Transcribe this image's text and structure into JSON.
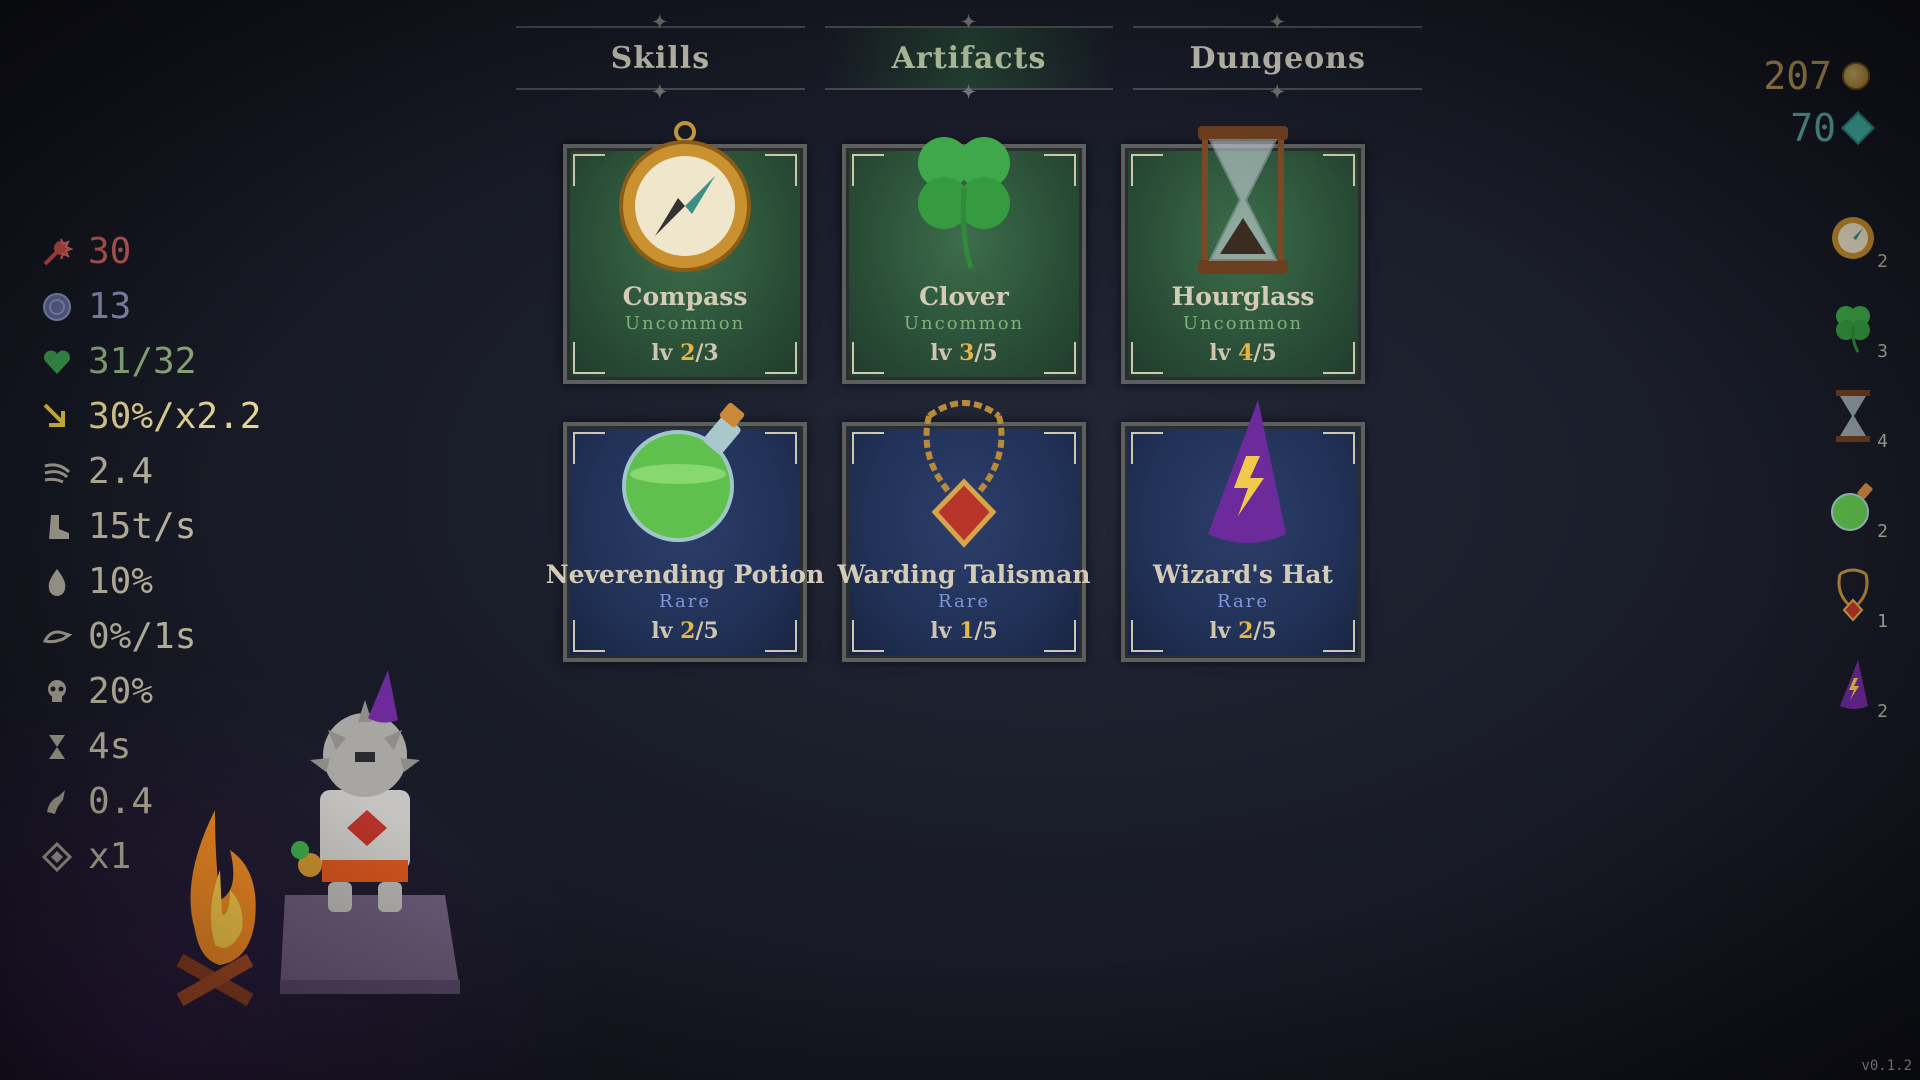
{
  "tabs": [
    {
      "label": "Skills",
      "active": false
    },
    {
      "label": "Artifacts",
      "active": true
    },
    {
      "label": "Dungeons",
      "active": false
    }
  ],
  "currency": {
    "gold": "207",
    "gems": "70"
  },
  "stats": [
    {
      "icon": "attack-icon",
      "value": "30"
    },
    {
      "icon": "armor-icon",
      "value": "13"
    },
    {
      "icon": "heart-icon",
      "value": "31/32"
    },
    {
      "icon": "crit-icon",
      "value": "30%/x2.2"
    },
    {
      "icon": "speed-icon",
      "value": "2.4"
    },
    {
      "icon": "boot-icon",
      "value": "15t/s"
    },
    {
      "icon": "drop-icon",
      "value": "10%"
    },
    {
      "icon": "regen-icon",
      "value": "0%/1s"
    },
    {
      "icon": "skull-icon",
      "value": "20%"
    },
    {
      "icon": "hourglass-icon",
      "value": "4s"
    },
    {
      "icon": "knockback-icon",
      "value": "0.4"
    },
    {
      "icon": "multiplier-icon",
      "value": "x1"
    }
  ],
  "artifacts": [
    {
      "name": "Compass",
      "rarity": "Uncommon",
      "level_prefix": "lv",
      "level_current": "2",
      "level_max": "/3",
      "icon": "compass-icon"
    },
    {
      "name": "Clover",
      "rarity": "Uncommon",
      "level_prefix": "lv",
      "level_current": "3",
      "level_max": "/5",
      "icon": "clover-icon"
    },
    {
      "name": "Hourglass",
      "rarity": "Uncommon",
      "level_prefix": "lv",
      "level_current": "4",
      "level_max": "/5",
      "icon": "hourglass-icon"
    },
    {
      "name": "Neverending Potion",
      "rarity": "Rare",
      "level_prefix": "lv",
      "level_current": "2",
      "level_max": "/5",
      "icon": "potion-icon"
    },
    {
      "name": "Warding Talisman",
      "rarity": "Rare",
      "level_prefix": "lv",
      "level_current": "1",
      "level_max": "/5",
      "icon": "talisman-icon"
    },
    {
      "name": "Wizard's Hat",
      "rarity": "Rare",
      "level_prefix": "lv",
      "level_current": "2",
      "level_max": "/5",
      "icon": "wizard-hat-icon"
    }
  ],
  "inventory": [
    {
      "icon": "compass-icon",
      "count": "2"
    },
    {
      "icon": "clover-icon",
      "count": "3"
    },
    {
      "icon": "hourglass-icon",
      "count": "4"
    },
    {
      "icon": "potion-icon",
      "count": "2"
    },
    {
      "icon": "talisman-icon",
      "count": "1"
    },
    {
      "icon": "wizard-hat-icon",
      "count": "2"
    }
  ],
  "version": "v0.1.2",
  "colors": {
    "uncommon": "#2a4e37",
    "rare": "#213157",
    "gold": "#c9a35e",
    "gem": "#5fb8b3",
    "level_highlight": "#e6b548"
  }
}
